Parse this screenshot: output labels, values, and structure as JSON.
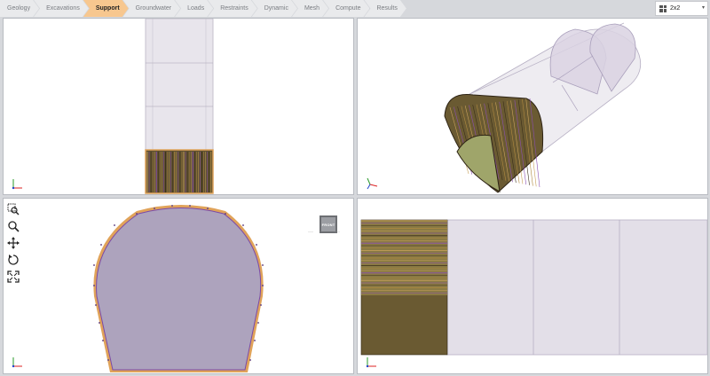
{
  "workflow_tabs": [
    {
      "label": "Geology",
      "active": false
    },
    {
      "label": "Excavations",
      "active": false
    },
    {
      "label": "Support",
      "active": true
    },
    {
      "label": "Groundwater",
      "active": false
    },
    {
      "label": "Loads",
      "active": false
    },
    {
      "label": "Restraints",
      "active": false
    },
    {
      "label": "Dynamic",
      "active": false
    },
    {
      "label": "Mesh",
      "active": false
    },
    {
      "label": "Compute",
      "active": false
    },
    {
      "label": "Results",
      "active": false
    }
  ],
  "layout_select": {
    "value": "2x2",
    "icon": "grid-2x2-icon"
  },
  "view_tools": [
    {
      "icon": "zoom-window-icon"
    },
    {
      "icon": "zoom-icon"
    },
    {
      "icon": "pan-icon"
    },
    {
      "icon": "rotate-icon"
    },
    {
      "icon": "zoom-extents-icon"
    }
  ],
  "view_cube": {
    "face_label": "FRONT"
  },
  "colors": {
    "active_tab": "#f7c78f",
    "tunnel_fill": "#ada3bd",
    "tunnel_outline": "#7a4aa8",
    "liner": "#e0a35a",
    "supported_section": "#6a5a32",
    "shell": "#e3dfe8"
  }
}
